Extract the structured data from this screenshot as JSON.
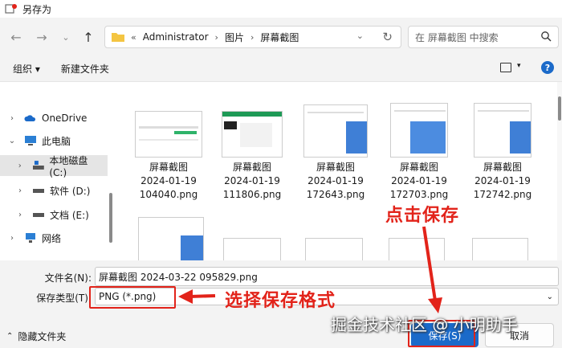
{
  "window": {
    "title": "另存为"
  },
  "nav": {
    "breadcrumb": [
      "«",
      "Administrator",
      "图片",
      "屏幕截图"
    ],
    "search_placeholder": "在 屏幕截图 中搜索"
  },
  "toolbar": {
    "organize": "组织 ▾",
    "new_folder": "新建文件夹",
    "help": "?"
  },
  "sidebar": {
    "items": [
      {
        "label": "OneDrive",
        "icon": "cloud-icon"
      },
      {
        "label": "此电脑",
        "icon": "pc-icon"
      },
      {
        "label": "本地磁盘 (C:)",
        "icon": "drive-icon"
      },
      {
        "label": "软件 (D:)",
        "icon": "drive-icon"
      },
      {
        "label": "文档 (E:)",
        "icon": "drive-icon"
      },
      {
        "label": "网络",
        "icon": "network-icon"
      }
    ]
  },
  "files": [
    {
      "name": "屏幕截图",
      "date": "2024-01-19",
      "time": "104040.png"
    },
    {
      "name": "屏幕截图",
      "date": "2024-01-19",
      "time": "111806.png"
    },
    {
      "name": "屏幕截图",
      "date": "2024-01-19",
      "time": "172643.png"
    },
    {
      "name": "屏幕截图",
      "date": "2024-01-19",
      "time": "172703.png"
    },
    {
      "name": "屏幕截图",
      "date": "2024-01-19",
      "time": "172742.png"
    }
  ],
  "form": {
    "filename_label": "文件名(N):",
    "filename_value": "屏幕截图 2024-03-22 095829.png",
    "filetype_label": "保存类型(T):",
    "filetype_value": "PNG (*.png)",
    "hide_folders": "隐藏文件夹",
    "save": "保存(S)",
    "cancel": "取消"
  },
  "annotations": {
    "click_save": "点击保存",
    "choose_format": "选择保存格式",
    "watermark": "掘金技术社区 @ 小明助手"
  },
  "colors": {
    "accent": "#1b6ac9",
    "annotation_red": "#e2231a"
  }
}
